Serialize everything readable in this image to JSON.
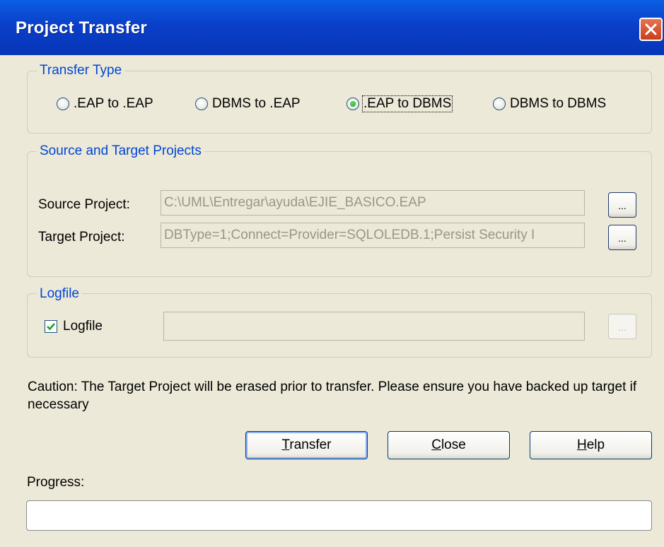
{
  "window": {
    "title": "Project Transfer"
  },
  "transfer_type": {
    "legend": "Transfer Type",
    "options": [
      {
        "label": ".EAP to .EAP",
        "selected": false
      },
      {
        "label": "DBMS to .EAP",
        "selected": false
      },
      {
        "label": ".EAP to DBMS",
        "selected": true
      },
      {
        "label": "DBMS to DBMS",
        "selected": false
      }
    ]
  },
  "projects": {
    "legend": "Source and Target Projects",
    "source_label": "Source Project:",
    "source_value": "C:\\UML\\Entregar\\ayuda\\EJIE_BASICO.EAP",
    "target_label": "Target Project:",
    "target_value": "DBType=1;Connect=Provider=SQLOLEDB.1;Persist Security I",
    "browse_label": "..."
  },
  "logfile": {
    "legend": "Logfile",
    "checkbox_label": "Logfile",
    "checked": true,
    "value": "",
    "browse_label": "..."
  },
  "caution": "Caution: The Target Project will be erased prior to transfer. Please ensure you have backed up target if necessary",
  "buttons": {
    "transfer": {
      "mnemonic": "T",
      "rest": "ransfer"
    },
    "close": {
      "mnemonic": "C",
      "rest": "lose"
    },
    "help": {
      "mnemonic": "H",
      "rest": "elp"
    }
  },
  "progress": {
    "label": "Progress:",
    "percent": 0
  },
  "colors": {
    "titlebar": "#0a3fc8",
    "legend_text": "#0046d5",
    "face": "#ece9d8",
    "close_button": "#d04c28"
  }
}
